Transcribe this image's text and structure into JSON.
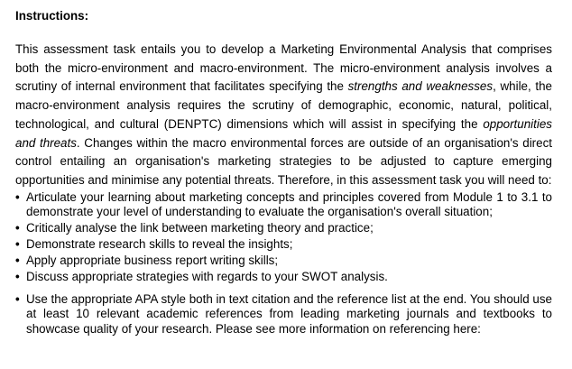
{
  "heading": "Instructions:",
  "paragraph": {
    "part1": "This assessment task entails you to develop a Marketing Environmental Analysis that comprises both the micro-environment and macro-environment. The micro-environment analysis involves a scrutiny of internal environment that facilitates specifying the ",
    "em1": "strengths and weaknesses",
    "part2": ", while, the macro-environment analysis requires the scrutiny of demographic, economic, natural, political, technological, and cultural (DENPTC) dimensions which will assist in specifying the ",
    "em2": "opportunities and threats",
    "part3": ". Changes within the macro environmental forces are outside of an organisation's direct control entailing an organisation's marketing strategies to be adjusted to capture emerging opportunities and minimise any potential threats. Therefore, in this assessment task you will need to:"
  },
  "bullets": [
    "Articulate your learning about marketing concepts and principles covered from Module 1 to 3.1 to demonstrate your level of understanding to evaluate the organisation's overall situation;",
    "Critically analyse the link between marketing theory and practice;",
    "Demonstrate research skills to reveal the insights;",
    "Apply appropriate business report writing skills;",
    "Discuss appropriate strategies with regards to your SWOT analysis."
  ],
  "bullets2": [
    "Use the appropriate APA style both in text citation and the reference list at the end. You should use at least 10 relevant academic references from leading marketing journals and textbooks to showcase quality of your research. Please see more information on referencing here:"
  ],
  "bullet_glyph": "•"
}
